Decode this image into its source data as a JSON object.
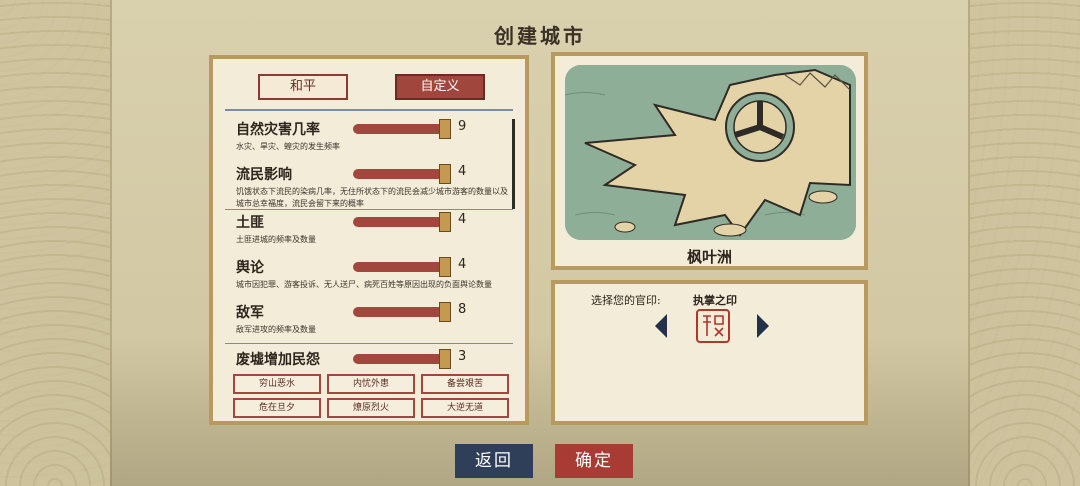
{
  "title": "创建城市",
  "mode_tabs": [
    "和平",
    "自定义"
  ],
  "settings": [
    {
      "label": "自然灾害几率",
      "value": "9",
      "level": 1.0,
      "desc": "水灾、旱灾、蝗灾的发生频率"
    },
    {
      "label": "流民影响",
      "value": "4",
      "level": 1.0,
      "desc": "饥饿状态下流民的染病几率，无住所状态下的流民会减少城市游客的数量以及城市总幸福度，流民会留下来的概率"
    },
    {
      "label": "土匪",
      "value": "4",
      "level": 1.0,
      "desc": "土匪进城的频率及数量"
    },
    {
      "label": "舆论",
      "value": "4",
      "level": 1.0,
      "desc": "城市因犯罪、游客投诉、无人送尸、病死百姓等原因出现的负面舆论数量"
    },
    {
      "label": "敌军",
      "value": "8",
      "level": 1.0,
      "desc": "敌军进攻的频率及数量"
    },
    {
      "label": "废墟增加民怨",
      "value": "3",
      "level": 1.0,
      "desc": ""
    }
  ],
  "presets": [
    "穷山恶水",
    "内忧外患",
    "备尝艰苦",
    "危在旦夕",
    "燎原烈火",
    "大逆无道"
  ],
  "map": {
    "name": "枫叶洲"
  },
  "seal": {
    "label": "选择您的官印:",
    "name": "执掌之印",
    "seal_text": "执掌之印",
    "icon": "seal-stamp-icon"
  },
  "buttons": {
    "back": "返回",
    "confirm": "确定"
  },
  "colors": {
    "accent_red": "#a83b34",
    "accent_blue": "#2f3e59",
    "panel": "#f3ecd8",
    "frame": "#b89a5e"
  }
}
